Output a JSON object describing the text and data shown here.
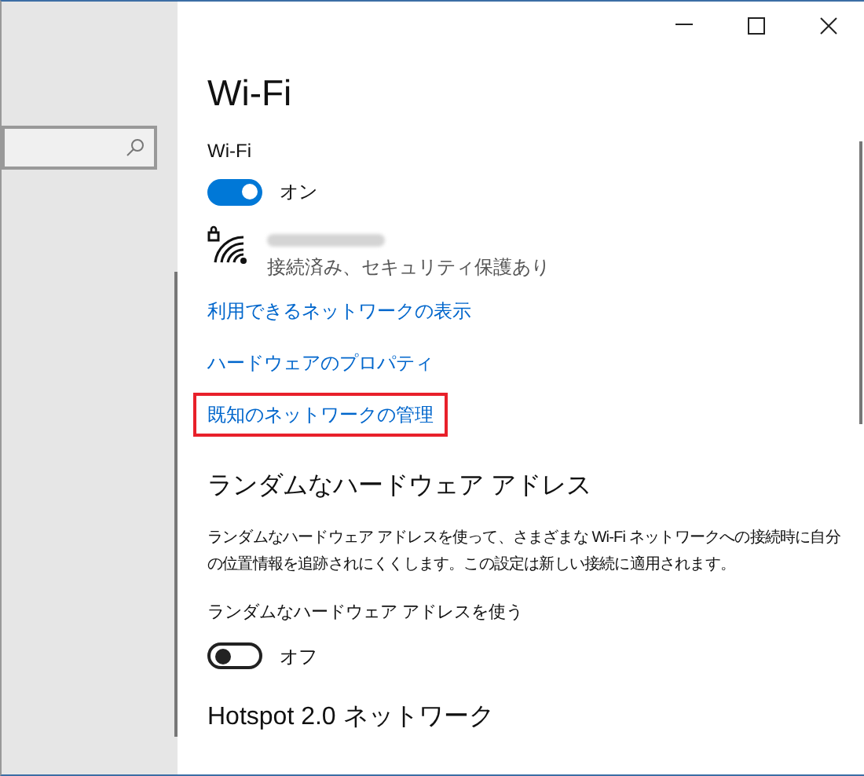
{
  "window": {
    "buttons": [
      {
        "kind": "minimize"
      },
      {
        "kind": "maximize"
      },
      {
        "kind": "close"
      }
    ]
  },
  "page": {
    "title": "Wi-Fi",
    "wifi": {
      "label": "Wi-Fi",
      "on": true,
      "state_text": "オン"
    },
    "network": {
      "status": "接続済み、セキュリティ保護あり"
    },
    "links": [
      {
        "text": "利用できるネットワークの表示",
        "highlighted": false
      },
      {
        "text": "ハードウェアのプロパティ",
        "highlighted": false
      },
      {
        "text": "既知のネットワークの管理",
        "highlighted": true
      }
    ],
    "random_address": {
      "heading": "ランダムなハードウェア アドレス",
      "description": "ランダムなハードウェア アドレスを使って、さまざまな Wi-Fi ネットワークへの接続時に自分の位置情報を追跡されにくくします。この設定は新しい接続に適用されます。",
      "toggle_label": "ランダムなハードウェア アドレスを使う",
      "on": false,
      "state_text": "オフ"
    },
    "hotspot": {
      "heading": "Hotspot 2.0 ネットワーク"
    }
  }
}
